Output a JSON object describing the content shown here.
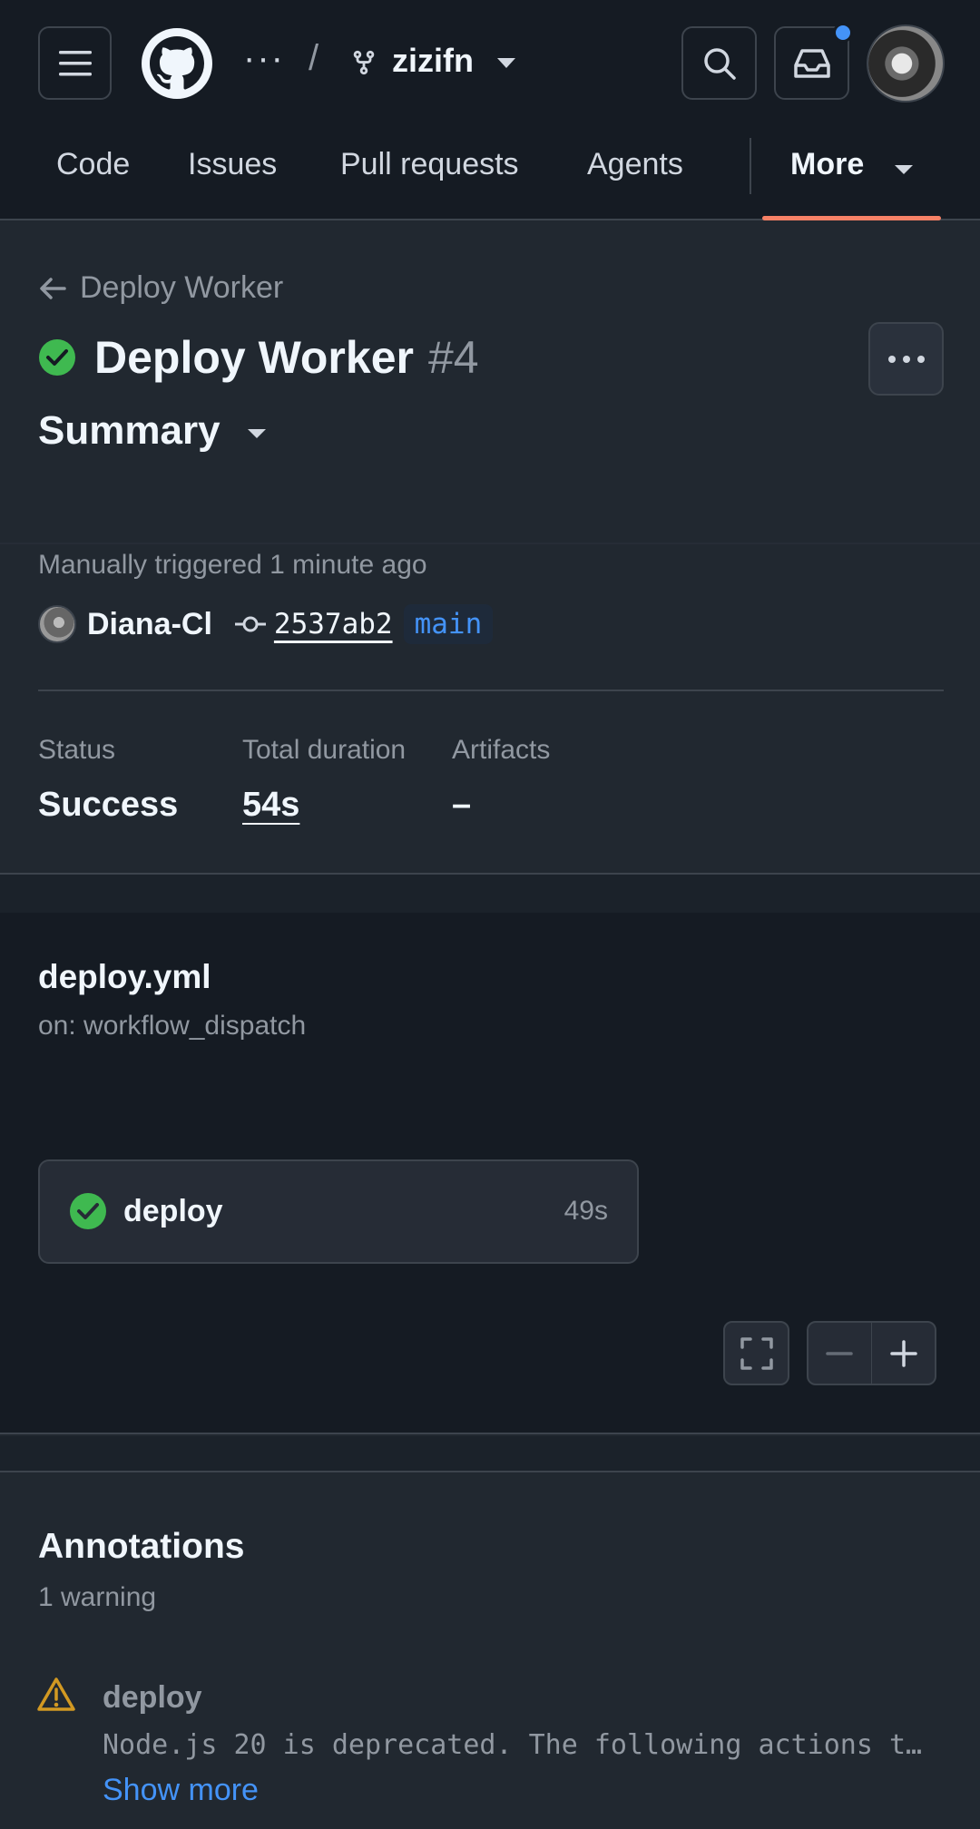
{
  "header": {
    "breadcrumb_ellipsis": "···",
    "breadcrumb_sep": "/",
    "repo_name": "zizifn"
  },
  "nav": {
    "items": [
      {
        "label": "Code"
      },
      {
        "label": "Issues"
      },
      {
        "label": "Pull requests"
      },
      {
        "label": "Agents"
      }
    ],
    "more_label": "More",
    "active": "More"
  },
  "run": {
    "back_label": "Deploy Worker",
    "title": "Deploy Worker",
    "number": "#4",
    "section_label": "Summary",
    "trigger_text": "Manually triggered 1 minute ago",
    "actor": "Diana-Cl",
    "commit_sha": "2537ab2",
    "branch": "main",
    "stats": {
      "status_label": "Status",
      "status_value": "Success",
      "duration_label": "Total duration",
      "duration_value": "54s",
      "artifacts_label": "Artifacts",
      "artifacts_value": "–"
    }
  },
  "workflow": {
    "file": "deploy.yml",
    "trigger": "on: workflow_dispatch",
    "jobs": [
      {
        "name": "deploy",
        "duration": "49s",
        "status": "success"
      }
    ]
  },
  "annotations": {
    "title": "Annotations",
    "count_text": "1 warning",
    "items": [
      {
        "job": "deploy",
        "message": "Node.js 20 is deprecated. The following actions t…",
        "level": "warning"
      }
    ],
    "show_more": "Show more"
  },
  "colors": {
    "background": "#212830",
    "header_bg": "#151b23",
    "success": "#3fb950",
    "accent_underline": "#f78166",
    "link": "#4493f8",
    "warning": "#d29922"
  }
}
